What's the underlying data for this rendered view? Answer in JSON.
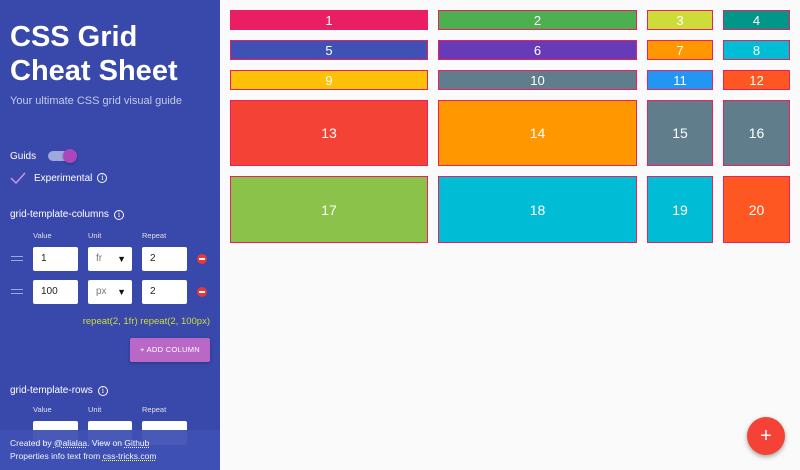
{
  "sidebar": {
    "title": "CSS Grid Cheat Sheet",
    "subtitle": "Your ultimate CSS grid visual guide",
    "guids_label": "Guids",
    "guids_on": true,
    "experimental_label": "Experimental",
    "info_glyph": "i",
    "columns_section": {
      "title": "grid-template-columns",
      "headers": {
        "value": "Value",
        "unit": "Unit",
        "repeat": "Repeat"
      },
      "rows": [
        {
          "value": "1",
          "unit": "fr",
          "repeat": "2"
        },
        {
          "value": "100",
          "unit": "px",
          "repeat": "2"
        }
      ],
      "css_output": "repeat(2, 1fr) repeat(2, 100px)",
      "add_label": "+ ADD COLUMN"
    },
    "rows_section": {
      "title": "grid-template-rows",
      "headers": {
        "value": "Value",
        "unit": "Unit",
        "repeat": "Repeat"
      }
    },
    "unit_caret": "▼"
  },
  "footer": {
    "line1_prefix": "Created by ",
    "author": "@alialaa",
    "line1_mid": ". View on ",
    "github": "Github",
    "line2_prefix": "Properties info text from ",
    "source": "css-tricks.com"
  },
  "grid": {
    "cells": [
      {
        "label": "1",
        "color": "#e91e63"
      },
      {
        "label": "2",
        "color": "#4caf50"
      },
      {
        "label": "3",
        "color": "#cddc39"
      },
      {
        "label": "4",
        "color": "#009688"
      },
      {
        "label": "5",
        "color": "#3f51b5"
      },
      {
        "label": "6",
        "color": "#673ab7"
      },
      {
        "label": "7",
        "color": "#ff9800"
      },
      {
        "label": "8",
        "color": "#00bcd4"
      },
      {
        "label": "9",
        "color": "#ffc107"
      },
      {
        "label": "10",
        "color": "#607d8b"
      },
      {
        "label": "11",
        "color": "#2196f3"
      },
      {
        "label": "12",
        "color": "#ff5722"
      },
      {
        "label": "13",
        "color": "#f44336"
      },
      {
        "label": "14",
        "color": "#ff9800"
      },
      {
        "label": "15",
        "color": "#607d8b"
      },
      {
        "label": "16",
        "color": "#607d8b"
      },
      {
        "label": "17",
        "color": "#8bc34a"
      },
      {
        "label": "18",
        "color": "#00bcd4"
      },
      {
        "label": "19",
        "color": "#00bcd4"
      },
      {
        "label": "20",
        "color": "#ff5722"
      }
    ]
  },
  "fab_label": "+"
}
